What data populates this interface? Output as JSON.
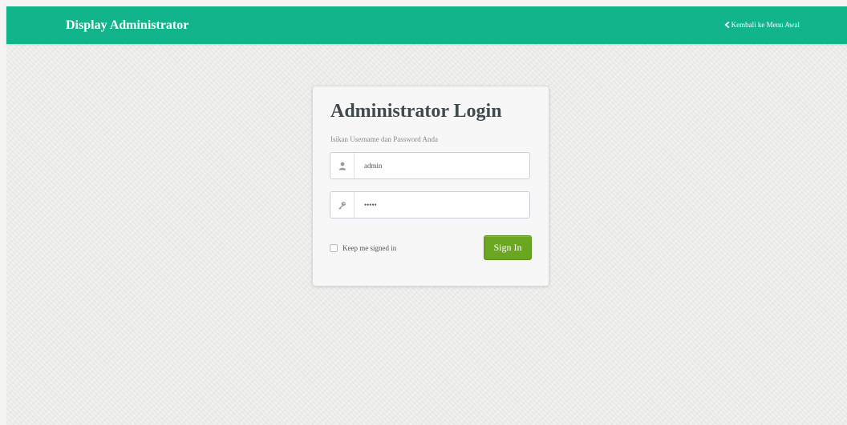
{
  "header": {
    "brand": "Display Administrator",
    "back_link": "Kembali ke Menu Awal"
  },
  "login": {
    "title": "Administrator Login",
    "subtitle": "Isikan Username dan Password Anda",
    "username": {
      "value": "admin",
      "icon": "user-icon"
    },
    "password": {
      "value": "•••••",
      "icon": "key-icon"
    },
    "remember_label": "Keep me signed in",
    "remember_checked": false,
    "signin_label": "Sign In"
  },
  "colors": {
    "navbar": "#12b48b",
    "button": "#6aa61f",
    "title": "#3f4a4f",
    "background": "#ededeb"
  }
}
